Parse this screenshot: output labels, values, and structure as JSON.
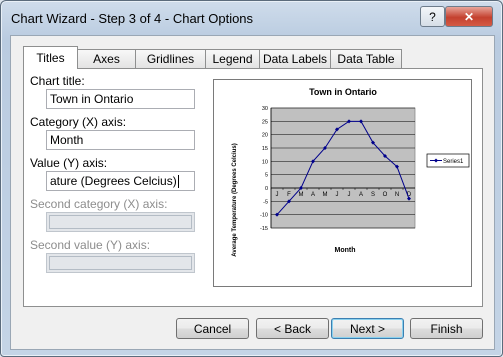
{
  "window": {
    "title": "Chart Wizard - Step 3 of 4 - Chart Options",
    "help_label": "?",
    "close_label": "✕"
  },
  "tabs": [
    {
      "label": "Titles"
    },
    {
      "label": "Axes"
    },
    {
      "label": "Gridlines"
    },
    {
      "label": "Legend"
    },
    {
      "label": "Data Labels"
    },
    {
      "label": "Data Table"
    }
  ],
  "form": {
    "chart_title_label": "Chart title:",
    "chart_title_value": "Town in Ontario",
    "category_x_label": "Category (X) axis:",
    "category_x_value": "Month",
    "value_y_label": "Value (Y) axis:",
    "value_y_value": "ature (Degrees Celcius)",
    "second_category_label": "Second category (X) axis:",
    "second_value_label": "Second value (Y) axis:"
  },
  "buttons": {
    "cancel": "Cancel",
    "back": "< Back",
    "next": "Next >",
    "finish": "Finish"
  },
  "chart_data": {
    "type": "line",
    "title": "Town in Ontario",
    "xlabel": "Month",
    "ylabel": "Average Temperature (Degrees Celcius)",
    "categories": [
      "J",
      "F",
      "M",
      "A",
      "M",
      "J",
      "J",
      "A",
      "S",
      "O",
      "N",
      "D"
    ],
    "series": [
      {
        "name": "Series1",
        "values": [
          -10,
          -5,
          0,
          10,
          15,
          22,
          25,
          25,
          17,
          12,
          8,
          -4
        ],
        "color": "#00008b"
      }
    ],
    "ylim": [
      -15,
      30
    ],
    "yticks": [
      -15,
      -10,
      -5,
      0,
      5,
      10,
      15,
      20,
      25,
      30
    ],
    "grid": true,
    "plot_background": "#c0c0c0",
    "legend": "right"
  }
}
